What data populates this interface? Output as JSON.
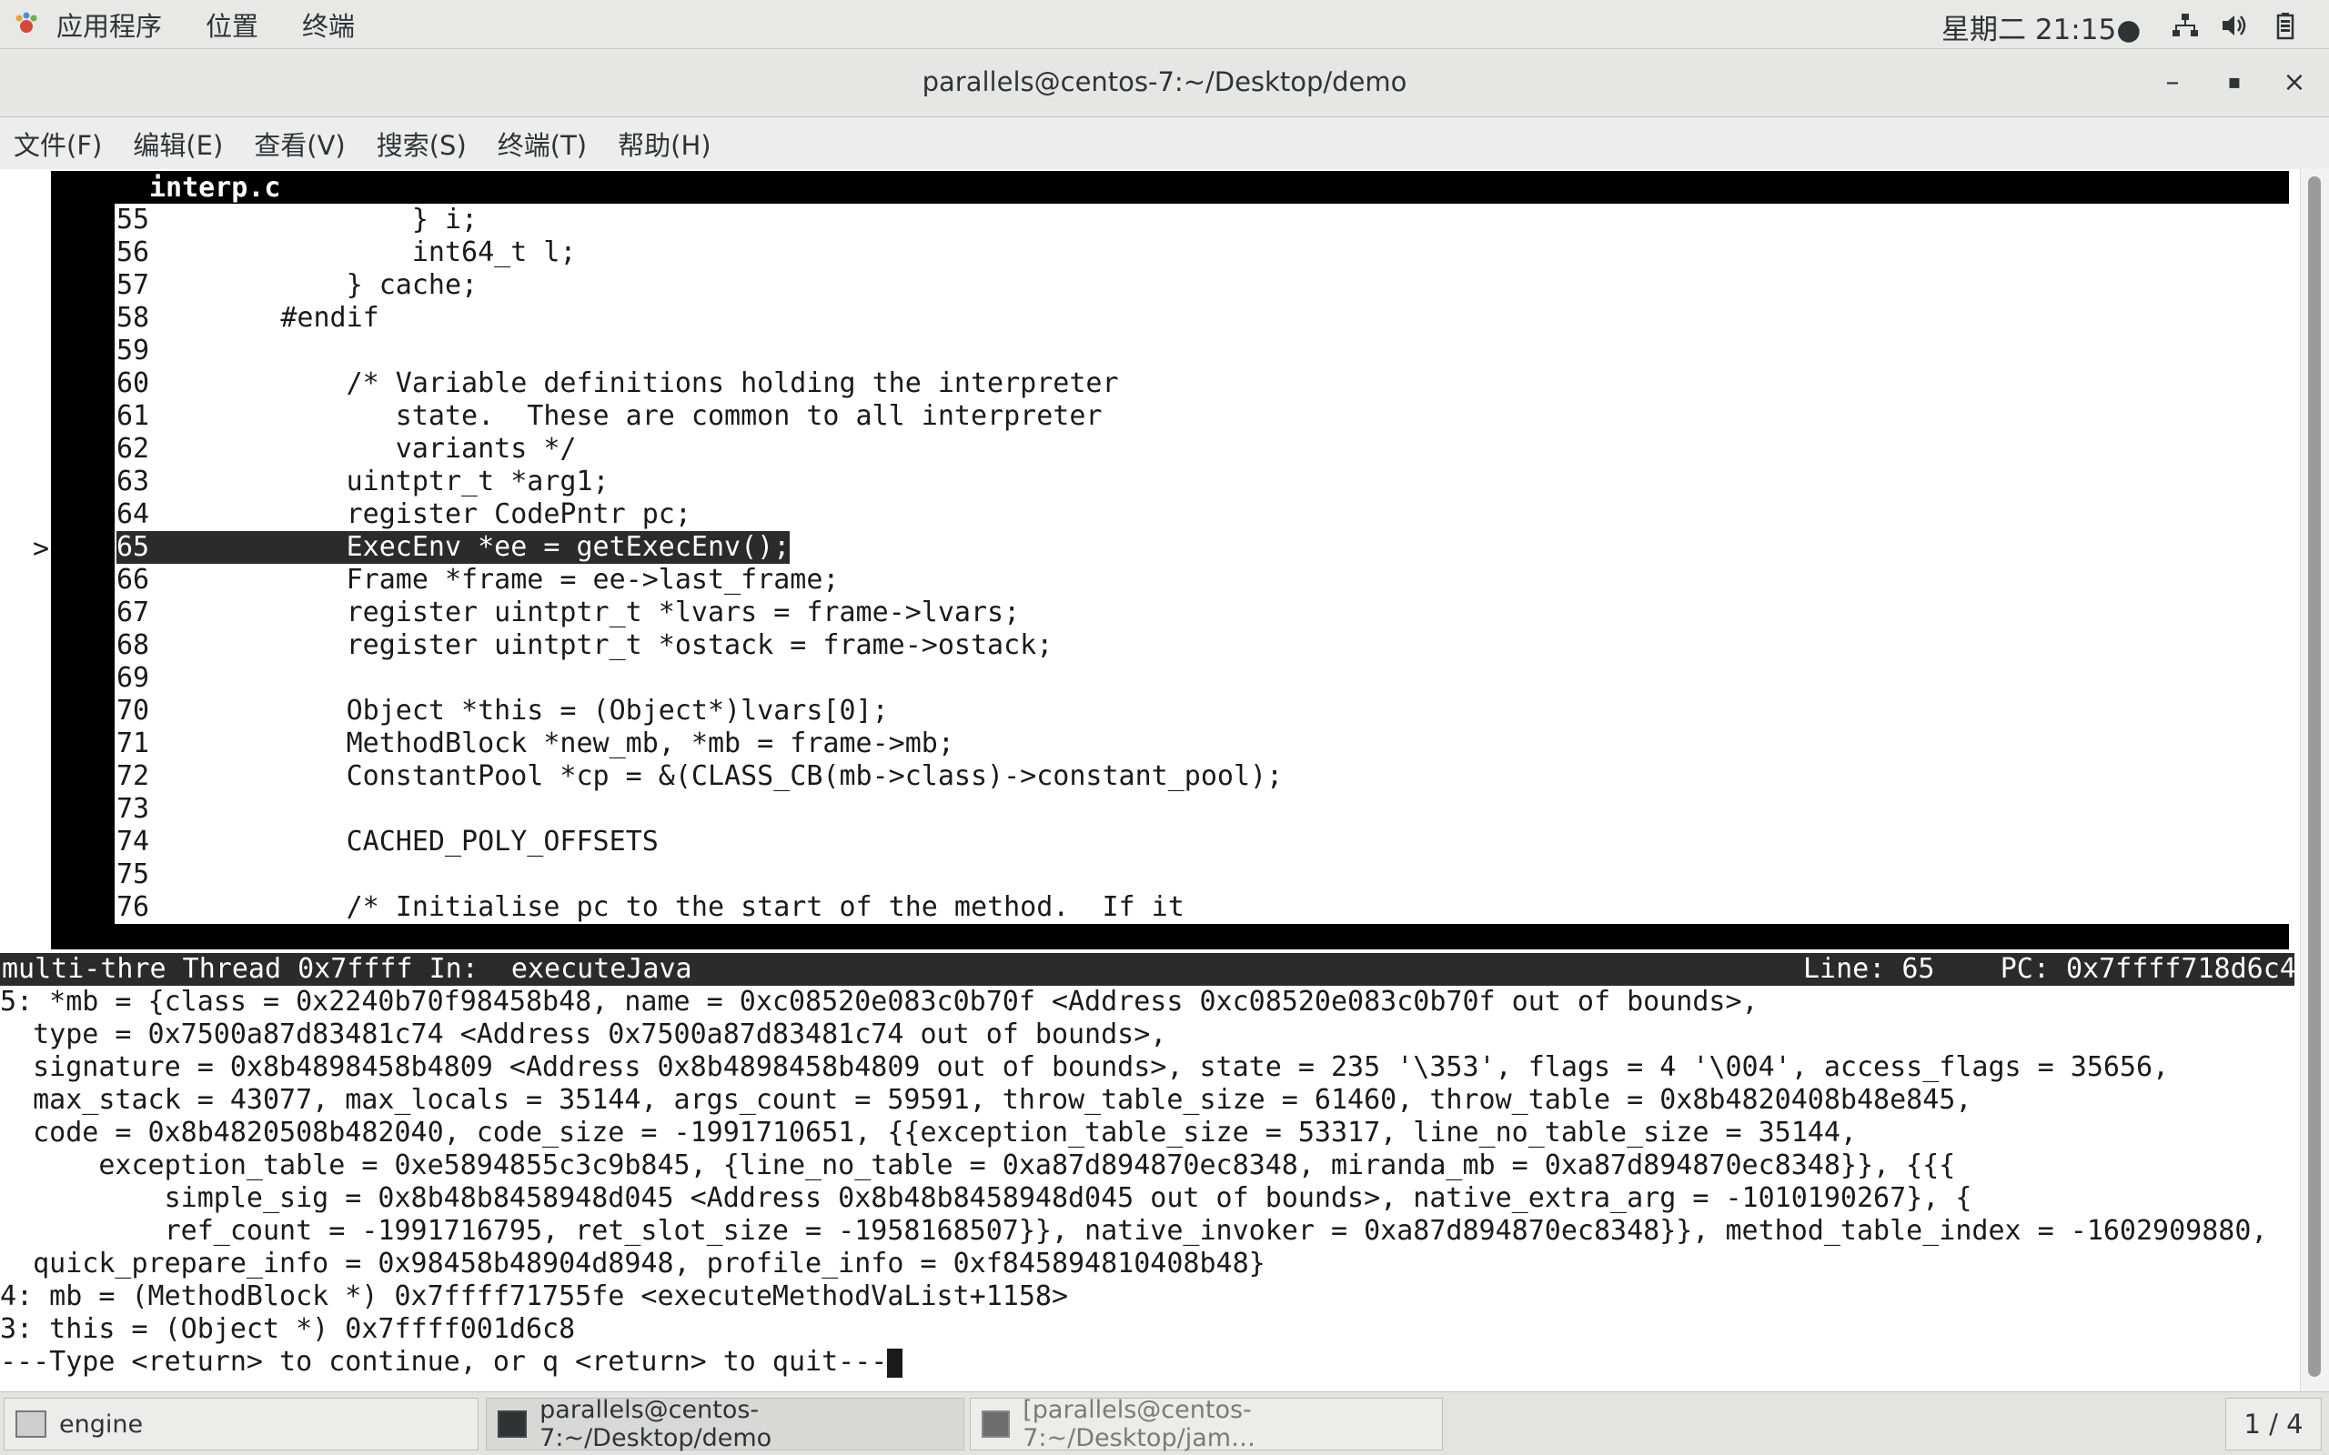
{
  "top_panel": {
    "menus": [
      "应用程序",
      "位置",
      "终端"
    ],
    "clock": "星期二 21:15●"
  },
  "window": {
    "title": "parallels@centos-7:~/Desktop/demo",
    "buttons": [
      "–",
      "▪",
      "×"
    ]
  },
  "terminal_menu": [
    "文件(F)",
    "编辑(E)",
    "查看(V)",
    "搜索(S)",
    "终端(T)",
    "帮助(H)"
  ],
  "source_window": {
    "filename": "interp.c",
    "current_line_marker": ">",
    "lines": [
      {
        "n": "55",
        "code": "              } i;"
      },
      {
        "n": "56",
        "code": "              int64_t l;"
      },
      {
        "n": "57",
        "code": "          } cache;"
      },
      {
        "n": "58",
        "code": "      #endif"
      },
      {
        "n": "59",
        "code": ""
      },
      {
        "n": "60",
        "code": "          /* Variable definitions holding the interpreter"
      },
      {
        "n": "61",
        "code": "             state.  These are common to all interpreter"
      },
      {
        "n": "62",
        "code": "             variants */"
      },
      {
        "n": "63",
        "code": "          uintptr_t *arg1;"
      },
      {
        "n": "64",
        "code": "          register CodePntr pc;"
      },
      {
        "n": "65",
        "code": "          ExecEnv *ee = getExecEnv();"
      },
      {
        "n": "66",
        "code": "          Frame *frame = ee->last_frame;"
      },
      {
        "n": "67",
        "code": "          register uintptr_t *lvars = frame->lvars;"
      },
      {
        "n": "68",
        "code": "          register uintptr_t *ostack = frame->ostack;"
      },
      {
        "n": "69",
        "code": ""
      },
      {
        "n": "70",
        "code": "          Object *this = (Object*)lvars[0];"
      },
      {
        "n": "71",
        "code": "          MethodBlock *new_mb, *mb = frame->mb;"
      },
      {
        "n": "72",
        "code": "          ConstantPool *cp = &(CLASS_CB(mb->class)->constant_pool);"
      },
      {
        "n": "73",
        "code": ""
      },
      {
        "n": "74",
        "code": "          CACHED_POLY_OFFSETS"
      },
      {
        "n": "75",
        "code": ""
      },
      {
        "n": "76",
        "code": "          /* Initialise pc to the start of the method.  If it"
      }
    ]
  },
  "status_bar": {
    "left": "multi-thre Thread 0x7ffff In:  executeJava",
    "right": "Line: 65    PC: 0x7ffff718d6c4"
  },
  "gdb_output": [
    "5: *mb = {class = 0x2240b70f98458b48, name = 0xc08520e083c0b70f <Address 0xc08520e083c0b70f out of bounds>,",
    "  type = 0x7500a87d83481c74 <Address 0x7500a87d83481c74 out of bounds>,",
    "  signature = 0x8b4898458b4809 <Address 0x8b4898458b4809 out of bounds>, state = 235 '\\353', flags = 4 '\\004', access_flags = 35656,",
    "  max_stack = 43077, max_locals = 35144, args_count = 59591, throw_table_size = 61460, throw_table = 0x8b4820408b48e845,",
    "  code = 0x8b4820508b482040, code_size = -1991710651, {{exception_table_size = 53317, line_no_table_size = 35144,",
    "      exception_table = 0xe5894855c3c9b845, {line_no_table = 0xa87d894870ec8348, miranda_mb = 0xa87d894870ec8348}}, {{{",
    "          simple_sig = 0x8b48b8458948d045 <Address 0x8b48b8458948d045 out of bounds>, native_extra_arg = -1010190267}, {",
    "          ref_count = -1991716795, ret_slot_size = -1958168507}}, native_invoker = 0xa87d894870ec8348}}, method_table_index = -1602909880,",
    "  quick_prepare_info = 0x98458b48904d8948, profile_info = 0xf845894810408b48}",
    "4: mb = (MethodBlock *) 0x7ffff71755fe <executeMethodVaList+1158>",
    "3: this = (Object *) 0x7ffff001d6c8",
    "---Type <return> to continue, or q <return> to quit---"
  ],
  "taskbar": {
    "tasks": [
      "engine",
      "parallels@centos-7:~/Desktop/demo",
      "[parallels@centos-7:~/Desktop/jam…"
    ],
    "workspace": "1 / 4"
  }
}
